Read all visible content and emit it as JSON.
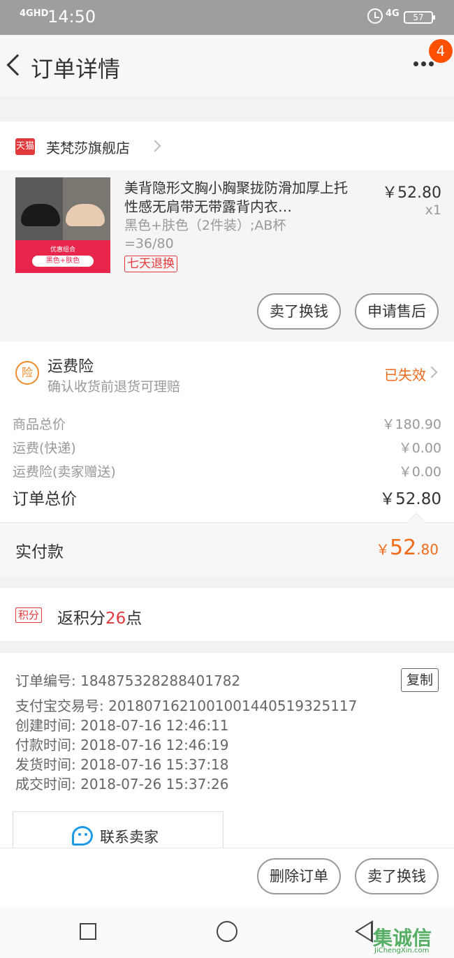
{
  "status_bar": {
    "network": "4GHD",
    "time": "14:50",
    "network2": "4G",
    "battery": "57"
  },
  "header": {
    "title": "订单详情",
    "badge_count": "4"
  },
  "shop": {
    "platform_icon": "天猫",
    "name": "芙梵莎旗舰店"
  },
  "product": {
    "title": "美背隐形文胸小胸聚拢防滑加厚上托性感无肩带无带露背内衣…",
    "sku": "黑色+肤色（2件装）;AB杯=36/80",
    "return_tag": "七天退换",
    "price": "￥52.80",
    "quantity": "x1",
    "thumb_banner": "优惠组合",
    "thumb_label": "黑色+肤色",
    "actions": {
      "sell": "卖了换钱",
      "after_sale": "申请售后"
    }
  },
  "insurance": {
    "icon": "险",
    "title": "运费险",
    "subtitle": "确认收货前退货可理赔",
    "status": "已失效"
  },
  "totals": {
    "rows": [
      {
        "label": "商品总价",
        "value": "￥180.90"
      },
      {
        "label": "运费(快递)",
        "value": "￥0.00"
      },
      {
        "label": "运费险(卖家赠送)",
        "value": "￥0.00"
      }
    ],
    "order_total": {
      "label": "订单总价",
      "value": "￥52.80"
    }
  },
  "paid": {
    "label": "实付款",
    "currency": "￥",
    "integer": "52",
    "decimal": ".80"
  },
  "points": {
    "tag": "积分",
    "prefix": "返积分",
    "number": "26",
    "suffix": "点"
  },
  "order_info": {
    "rows": [
      "订单编号: 184875328288401782",
      "支付宝交易号: 2018071621001001440519325117",
      "创建时间: 2018-07-16 12:46:11",
      "付款时间: 2018-07-16 12:46:19",
      "发货时间: 2018-07-16 15:37:18",
      "成交时间: 2018-07-26 15:37:26"
    ],
    "copy": "复制",
    "contact": "联系卖家"
  },
  "bottom_actions": {
    "delete": "删除订单",
    "sell": "卖了换钱"
  },
  "watermark": {
    "main": "集诚信",
    "sub": "JiChengXin.com"
  }
}
